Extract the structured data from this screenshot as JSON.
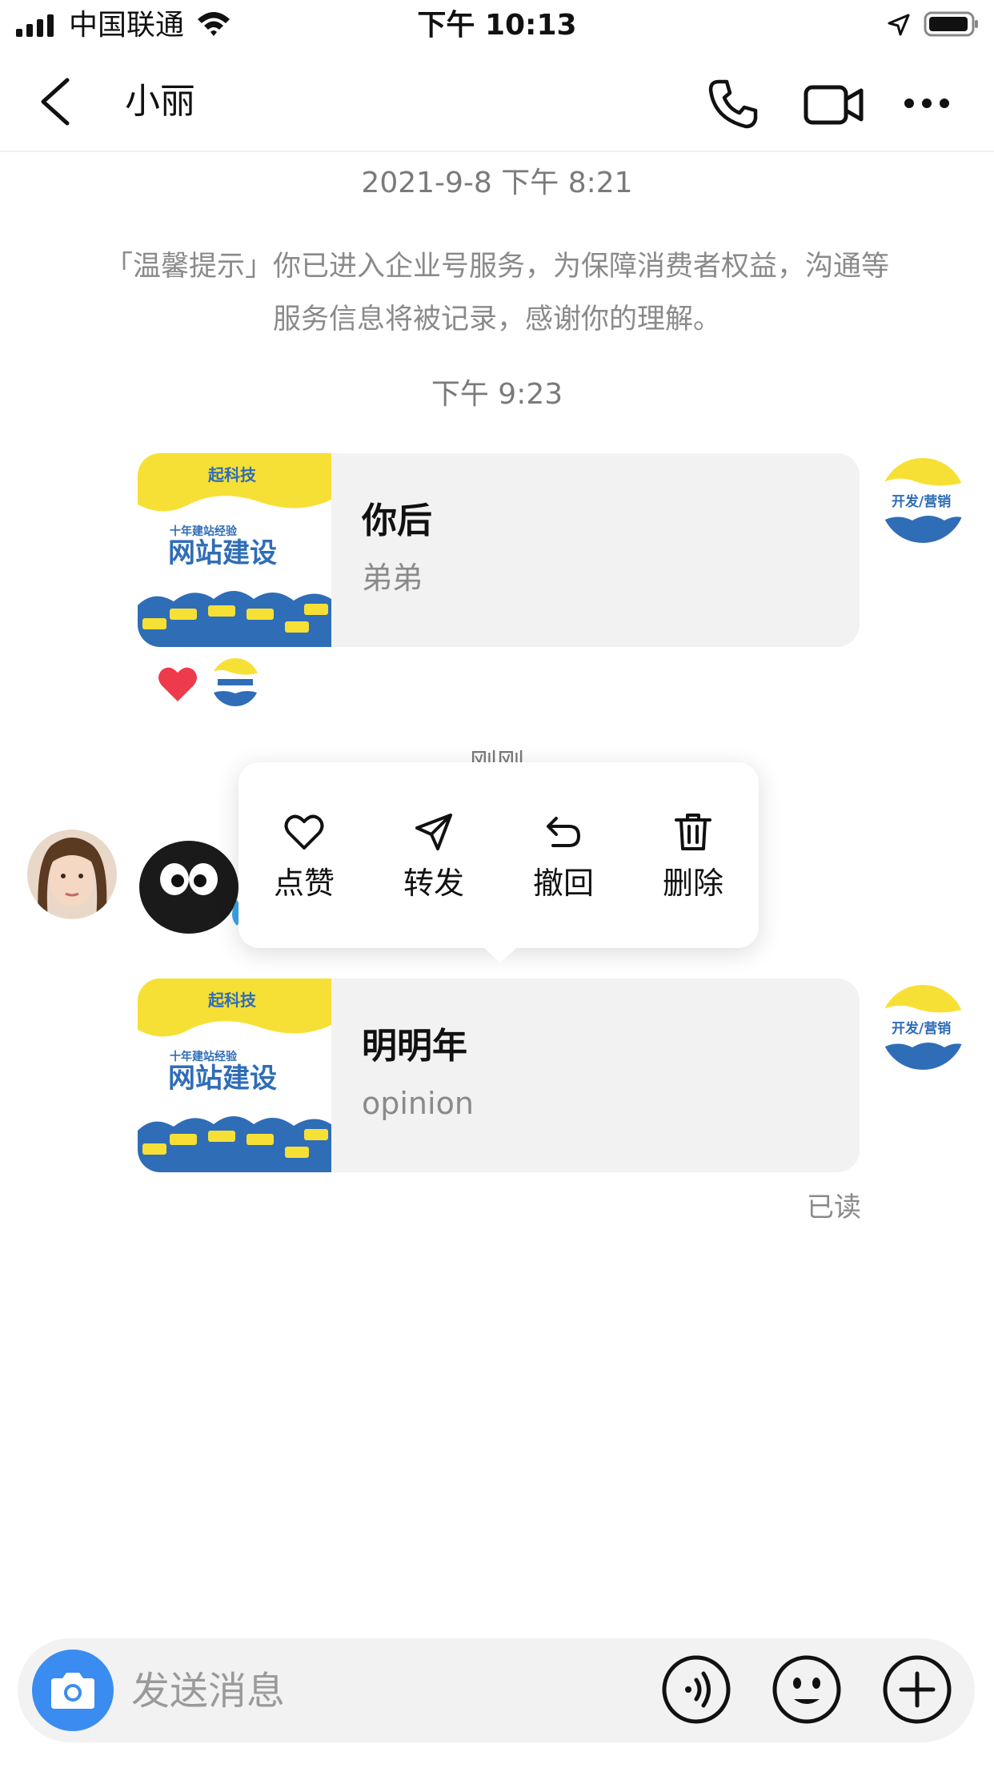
{
  "status_bar": {
    "carrier": "中国联通",
    "time": "下午 10:13"
  },
  "nav": {
    "title": "小丽"
  },
  "chat": {
    "timestamp_1": "2021-9-8 下午 8:21",
    "notice": "「温馨提示」你已进入企业号服务，为保障消费者权益，沟通等服务信息将被记录，感谢你的理解。",
    "timestamp_2": "下午 9:23",
    "timestamp_3": "刚刚",
    "messages": [
      {
        "title": "你后",
        "subtitle": "弟弟",
        "thumb_brand": "起科技",
        "thumb_tagline": "十年建站经验",
        "thumb_headline": "网站建设"
      },
      {
        "title": "明明年",
        "subtitle": "opinion",
        "thumb_brand": "起科技",
        "thumb_tagline": "十年建站经验",
        "thumb_headline": "网站建设",
        "status": "已读"
      }
    ],
    "reaction": {
      "icon": "heart-icon",
      "color": "#ee3b4b"
    }
  },
  "popup_menu": {
    "items": [
      {
        "label": "点赞",
        "icon": "heart-outline-icon"
      },
      {
        "label": "转发",
        "icon": "send-icon"
      },
      {
        "label": "撤回",
        "icon": "undo-icon"
      },
      {
        "label": "删除",
        "icon": "trash-icon"
      }
    ]
  },
  "input_bar": {
    "placeholder": "发送消息",
    "camera_color": "#3b8cf0"
  },
  "avatar_badge": {
    "line1": "开发/营销"
  }
}
